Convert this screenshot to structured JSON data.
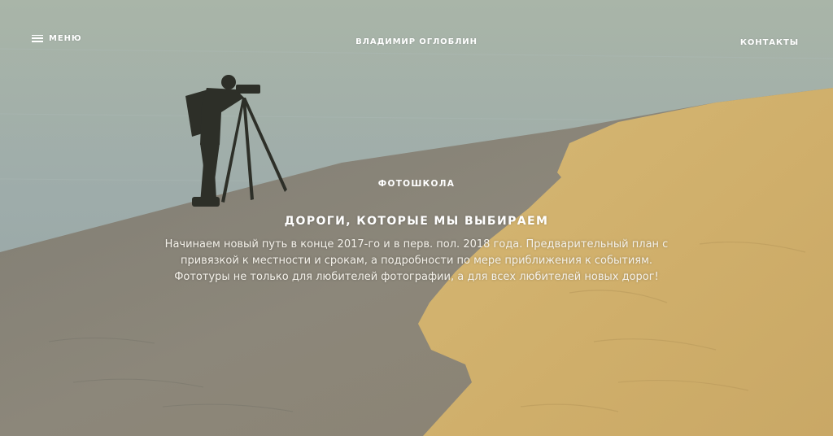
{
  "header": {
    "menu_label": "МЕНЮ",
    "site_title": "ВЛАДИМИР ОГЛОБЛИН",
    "contacts_label": "КОНТАКТЫ"
  },
  "hero": {
    "category": "ФОТОШКОЛА",
    "title": "ДОРОГИ, КОТОРЫЕ МЫ ВЫБИРАЕМ",
    "description": "Начинаем новый путь в конце 2017-го и в перв. пол. 2018 года. Предварительный план с привязкой к местности и срокам, а подробности по мере приближения к событиям. Фототуры не только для любителей фотографии, а для всех любителей новых дорог!"
  },
  "colors": {
    "sky_water": "#9aa9a6",
    "sand_light": "#d4b574",
    "sand_shadow": "#8f8a7c",
    "text": "#ffffff"
  },
  "icons": {
    "menu": "hamburger-icon"
  }
}
